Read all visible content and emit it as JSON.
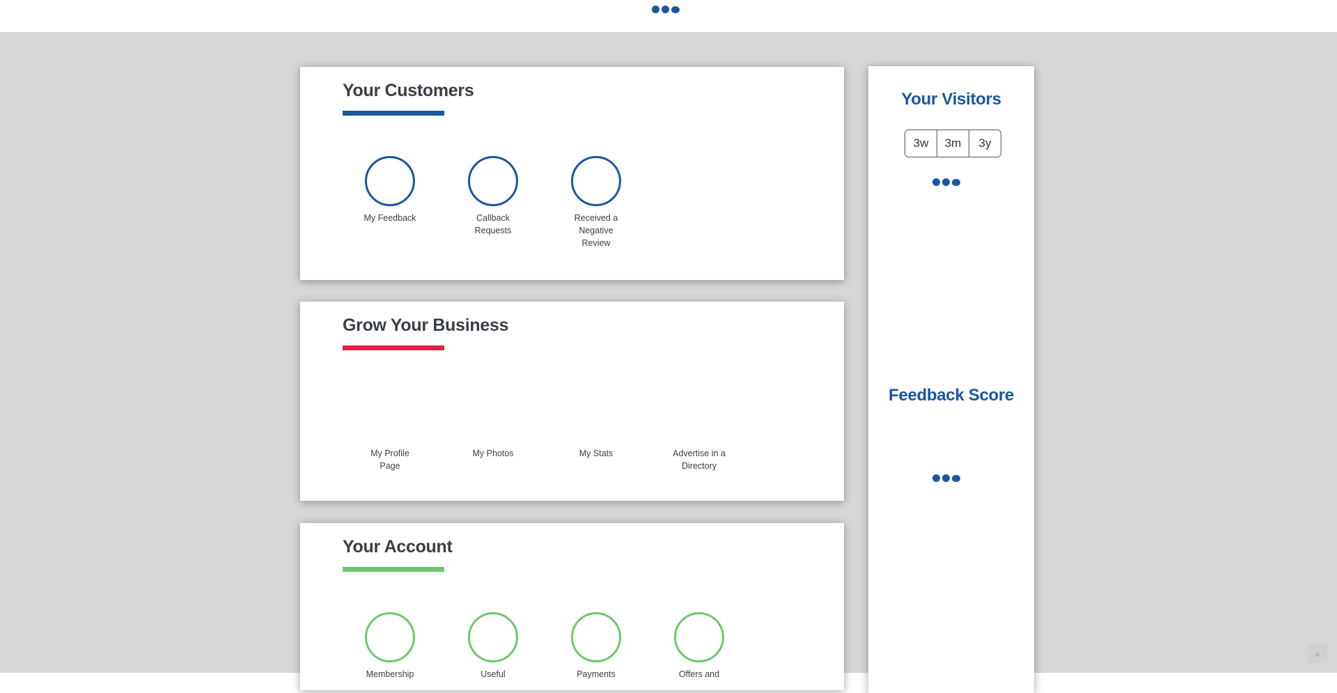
{
  "colors": {
    "brand_blue": "#1a56a0",
    "accent_red": "#e0223f",
    "accent_green": "#6cc86a",
    "background": "#d8d7d6"
  },
  "customers": {
    "title": "Your Customers",
    "items": [
      {
        "label": "My Feedback",
        "icon": "circle-outline-icon"
      },
      {
        "label": "Callback Requests",
        "icon": "circle-outline-icon"
      },
      {
        "label": "Received a Negative Review",
        "icon": "circle-outline-icon"
      }
    ]
  },
  "grow": {
    "title": "Grow Your Business",
    "items": [
      {
        "label": "My Profile Page"
      },
      {
        "label": "My Photos"
      },
      {
        "label": "My Stats"
      },
      {
        "label": "Advertise in a Directory"
      }
    ]
  },
  "account": {
    "title": "Your Account",
    "items": [
      {
        "label": "Membership",
        "icon": "circle-outline-icon"
      },
      {
        "label": "Useful",
        "icon": "circle-outline-icon"
      },
      {
        "label": "Payments",
        "icon": "circle-outline-icon"
      },
      {
        "label": "Offers and",
        "icon": "circle-outline-icon"
      }
    ]
  },
  "sidebar": {
    "visitors_title": "Your Visitors",
    "ranges": [
      "3w",
      "3m",
      "3y"
    ],
    "feedback_title": "Feedback Score"
  },
  "icons": {
    "loading": "loading-dots-icon",
    "back_to_top": "chevron-up-icon"
  }
}
